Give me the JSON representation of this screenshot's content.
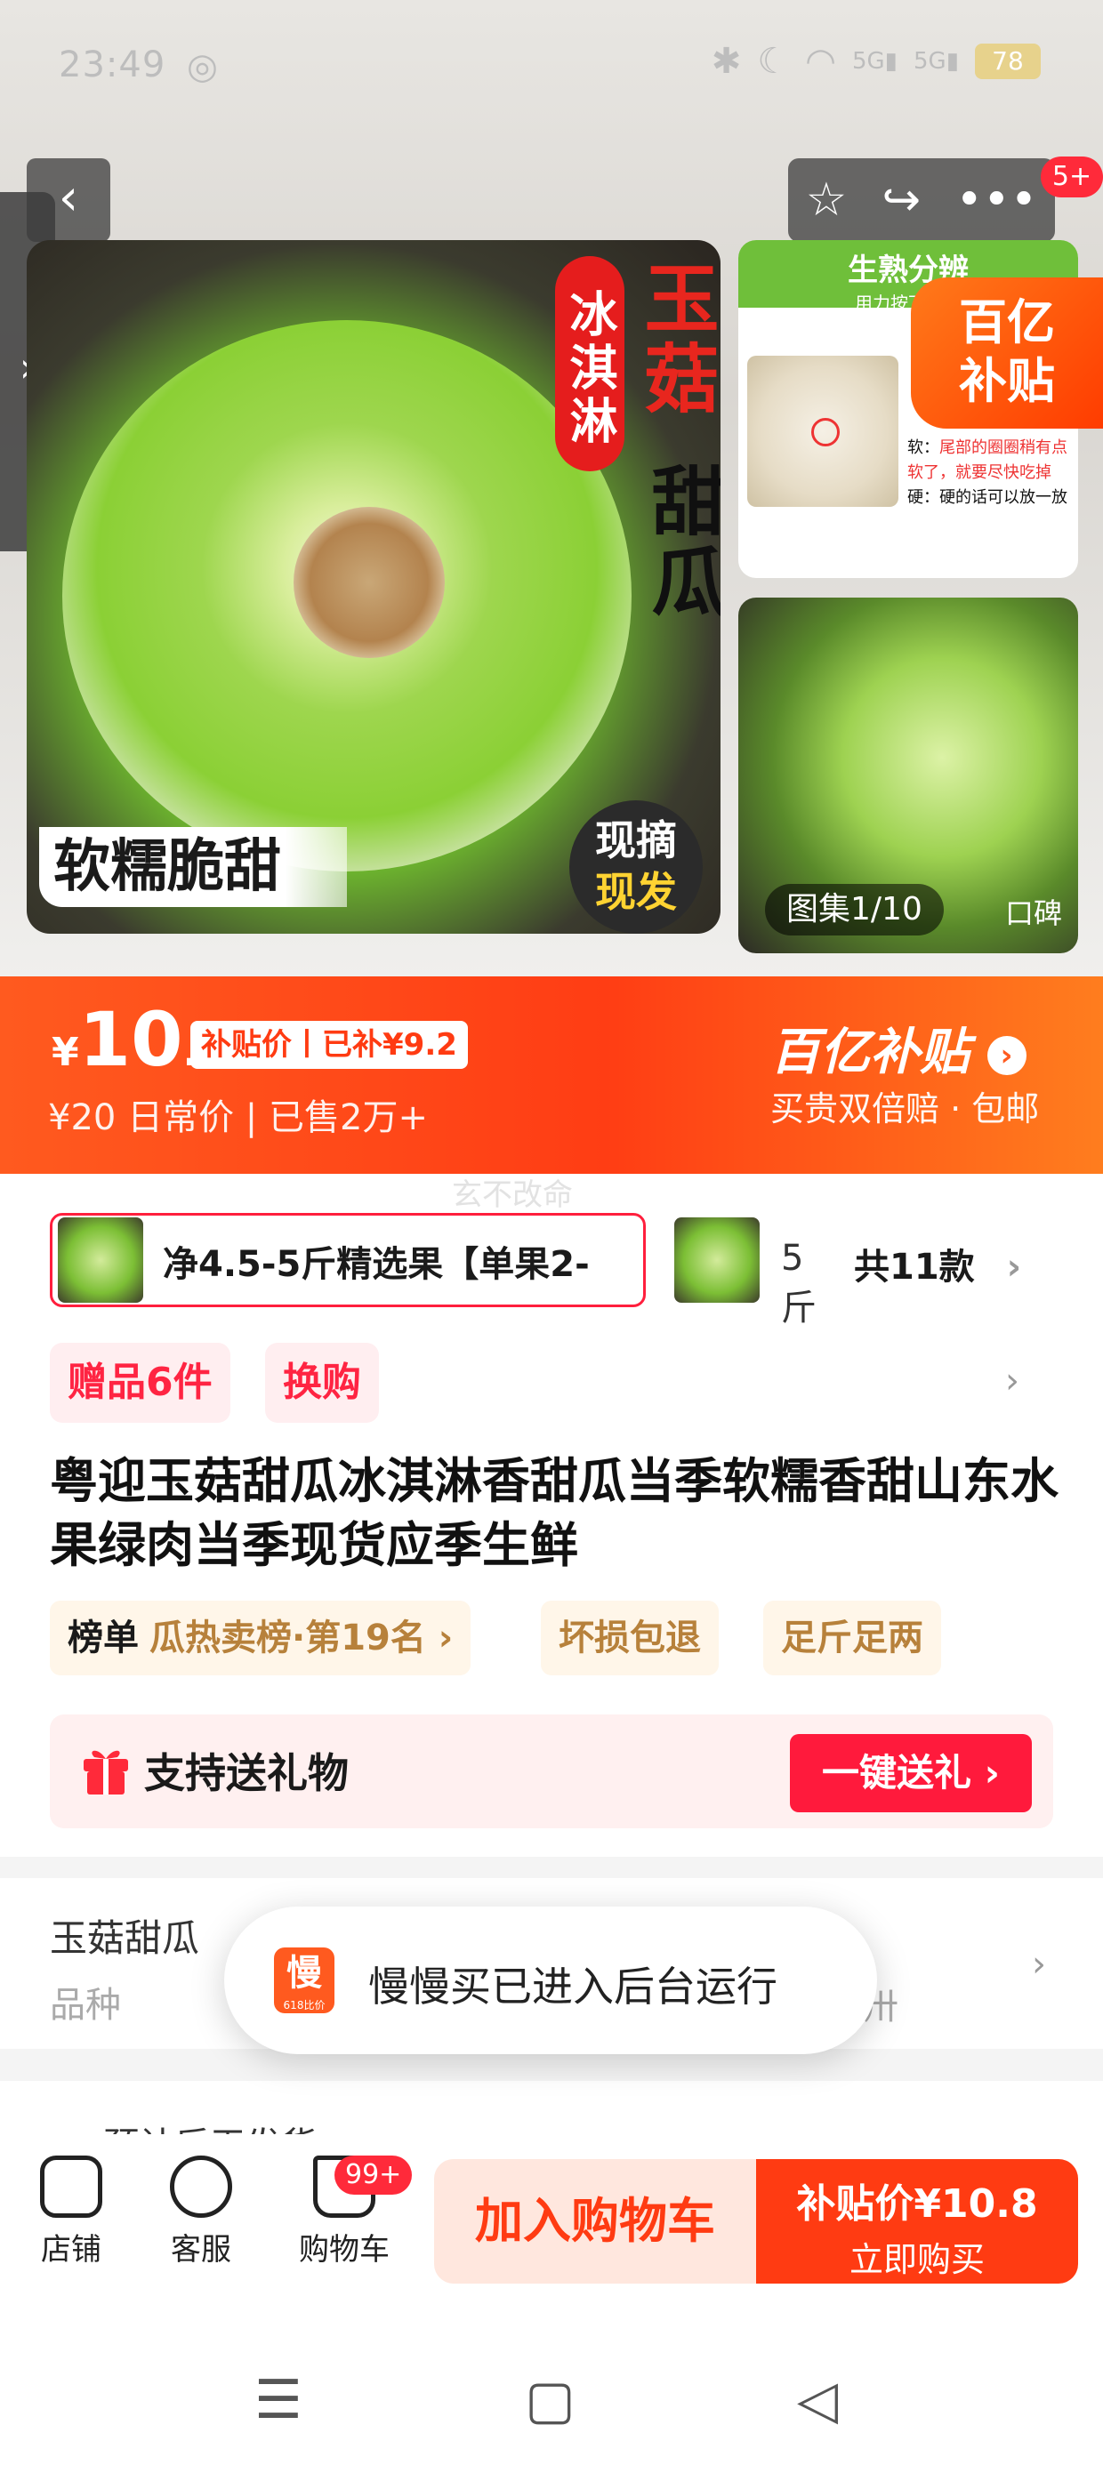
{
  "status_bar": {
    "time": "23:49",
    "battery": "78",
    "signal_1": "5G",
    "signal_2": "5G"
  },
  "nav": {
    "back_icon": "‹",
    "side_arrow": "›",
    "badge": "5+"
  },
  "gallery": {
    "main_tag_1": "冰淇淋",
    "main_tag_2": "玉菇",
    "main_tag_3": "甜瓜",
    "main_caption": "软糯脆甜",
    "fresh_1": "现摘",
    "fresh_2": "现发",
    "side_head_title": "生熟分辨",
    "side_head_sub": "用力按下瓜皮",
    "side_note_soft_key": "软：",
    "side_note_soft": "尾部的圈圈稍有点软了，就要尽快吃掉",
    "side_note_hard_key": "硬：",
    "side_note_hard": "硬的话可以放一放",
    "counter": "图集1/10",
    "counter_extra": "口碑"
  },
  "yi_float": {
    "line1": "百亿",
    "line2": "补贴"
  },
  "price": {
    "currency": "¥",
    "integer": "10",
    "decimal": ".8",
    "subsidy_chip": "补贴价丨已补¥9.2",
    "original": "¥20",
    "original_label": "日常价",
    "sold": "已售2万+",
    "brand": "百亿补贴",
    "brand_arrow": "›",
    "brand_sub": "买贵双倍赔 · 包邮"
  },
  "watermark": "玄不改命",
  "variants": {
    "selected": "净4.5-5斤精选果【单果2-",
    "second": "5斤",
    "count": "共11款",
    "chevron": "›"
  },
  "tags": {
    "gift": "赠品6件",
    "swap": "换购",
    "chevron": "›"
  },
  "product": {
    "title": "粤迎玉菇甜瓜冰淇淋香甜瓜当季软糯香甜山东水果绿肉当季现货应季生鲜"
  },
  "badges": {
    "rank_label": "榜单",
    "rank_value": "瓜热卖榜·第19名 ›",
    "damage": "坏损包退",
    "weight": "足斤足两"
  },
  "gift_bar": {
    "text": "支持送礼物",
    "button": "一键送礼 ›"
  },
  "spec": {
    "value": "玉菇甜瓜",
    "label": "品种",
    "tail": "卅",
    "chevron": "›"
  },
  "shipping": {
    "text": "预计后天发货"
  },
  "toast": {
    "app_char": "慢",
    "app_sub": "618比价",
    "text": "慢慢买已进入后台运行"
  },
  "actions": {
    "shop": "店铺",
    "service": "客服",
    "cart": "购物车",
    "cart_badge": "99+",
    "add_to_cart": "加入购物车",
    "buy_price": "补贴价¥10.8",
    "buy_now": "立即购买"
  },
  "colors": {
    "accent": "#ff3b12",
    "brand_red": "#ff1a3c"
  }
}
